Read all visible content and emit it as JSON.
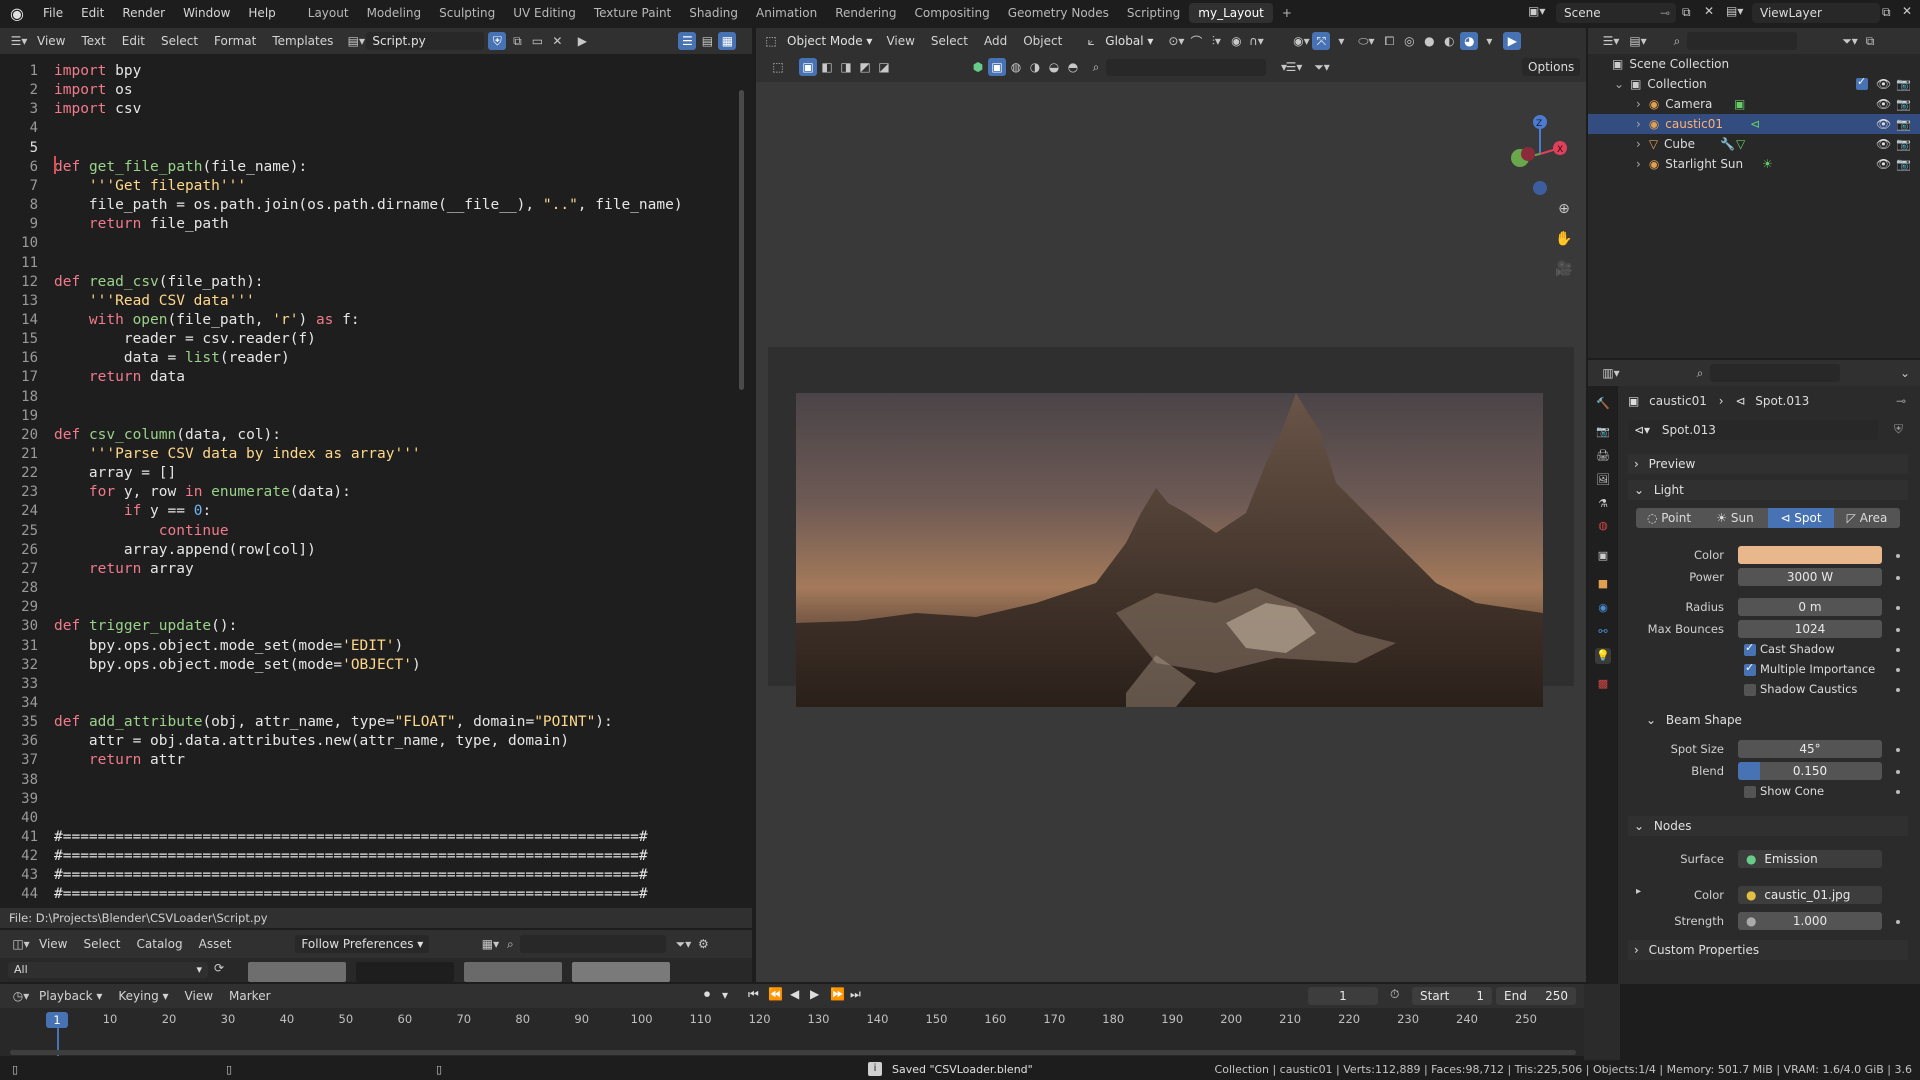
{
  "topbar": {
    "menus": [
      "File",
      "Edit",
      "Render",
      "Window",
      "Help"
    ],
    "workspaces": [
      "Layout",
      "Modeling",
      "Sculpting",
      "UV Editing",
      "Texture Paint",
      "Shading",
      "Animation",
      "Rendering",
      "Compositing",
      "Geometry Nodes",
      "Scripting",
      "my_Layout"
    ],
    "active_workspace": "my_Layout",
    "scene": "Scene",
    "view_layer": "ViewLayer"
  },
  "text_editor": {
    "menus": [
      "View",
      "Text",
      "Edit",
      "Select",
      "Format",
      "Templates"
    ],
    "filename": "Script.py",
    "footer": "File: D:\\Projects\\Blender\\CSVLoader\\Script.py",
    "lines": [
      "import bpy",
      "import os",
      "import csv",
      "",
      "",
      "def get_file_path(file_name):",
      "    '''Get filepath'''",
      "    file_path = os.path.join(os.path.dirname(__file__), \"..\", file_name)",
      "    return file_path",
      "",
      "",
      "def read_csv(file_path):",
      "    '''Read CSV data'''",
      "    with open(file_path, 'r') as f:",
      "        reader = csv.reader(f)",
      "        data = list(reader)",
      "    return data",
      "",
      "",
      "def csv_column(data, col):",
      "    '''Parse CSV data by index as array'''",
      "    array = []",
      "    for y, row in enumerate(data):",
      "        if y == 0:",
      "            continue",
      "        array.append(row[col])",
      "    return array",
      "",
      "",
      "def trigger_update():",
      "    bpy.ops.object.mode_set(mode='EDIT')",
      "    bpy.ops.object.mode_set(mode='OBJECT')",
      "",
      "",
      "def add_attribute(obj, attr_name, type=\"FLOAT\", domain=\"POINT\"):",
      "    attr = obj.data.attributes.new(attr_name, type, domain)",
      "    return attr",
      "",
      "",
      "",
      "#==================================================================#",
      "#==================================================================#",
      "#==================================================================#",
      "#==================================================================#"
    ]
  },
  "asset_browser": {
    "menus": [
      "View",
      "Select",
      "Catalog",
      "Asset"
    ],
    "preference": "Follow Preferences",
    "filter": "All"
  },
  "viewport": {
    "mode": "Object Mode",
    "menus": [
      "View",
      "Select",
      "Add",
      "Object"
    ],
    "orientation": "Global",
    "options": "Options"
  },
  "outliner": {
    "root": "Scene Collection",
    "collection": "Collection",
    "items": [
      "Camera",
      "caustic01",
      "Cube",
      "Starlight Sun"
    ],
    "selected": "caustic01"
  },
  "properties": {
    "breadcrumb_object": "caustic01",
    "breadcrumb_data": "Spot.013",
    "datablock": "Spot.013",
    "preview": "Preview",
    "light_section": "Light",
    "light_types": [
      "Point",
      "Sun",
      "Spot",
      "Area"
    ],
    "active_type": "Spot",
    "color_label": "Color",
    "color_value": "#e8b88c",
    "power_label": "Power",
    "power": "3000 W",
    "radius_label": "Radius",
    "radius": "0 m",
    "bounces_label": "Max Bounces",
    "max_bounces": "1024",
    "cast_shadow": "Cast Shadow",
    "multiple_importance": "Multiple Importance",
    "shadow_caustics": "Shadow Caustics",
    "beam_shape": "Beam Shape",
    "spot_size_label": "Spot Size",
    "spot_size": "45°",
    "blend_label": "Blend",
    "blend": "0.150",
    "blend_fraction": 0.15,
    "show_cone": "Show Cone",
    "nodes": "Nodes",
    "surface_label": "Surface",
    "surface": "Emission",
    "node_color_label": "Color",
    "node_color": "caustic_01.jpg",
    "strength_label": "Strength",
    "strength": "1.000",
    "custom_properties": "Custom Properties"
  },
  "timeline": {
    "menus": [
      "Playback",
      "Keying",
      "View",
      "Marker"
    ],
    "current_frame": "1",
    "start_label": "Start",
    "start": "1",
    "end_label": "End",
    "end": "250",
    "ticks": [
      "1",
      "10",
      "20",
      "30",
      "40",
      "50",
      "60",
      "70",
      "80",
      "90",
      "100",
      "110",
      "120",
      "130",
      "140",
      "150",
      "160",
      "170",
      "180",
      "190",
      "200",
      "210",
      "220",
      "230",
      "240",
      "250"
    ]
  },
  "status": {
    "message": "Saved \"CSVLoader.blend\"",
    "stats": "Collection | caustic01 | Verts:112,889 | Faces:98,712 | Tris:225,506 | Objects:1/4 | Memory: 501.7 MiB | VRAM: 1.6/4.0 GiB | 3.6"
  }
}
